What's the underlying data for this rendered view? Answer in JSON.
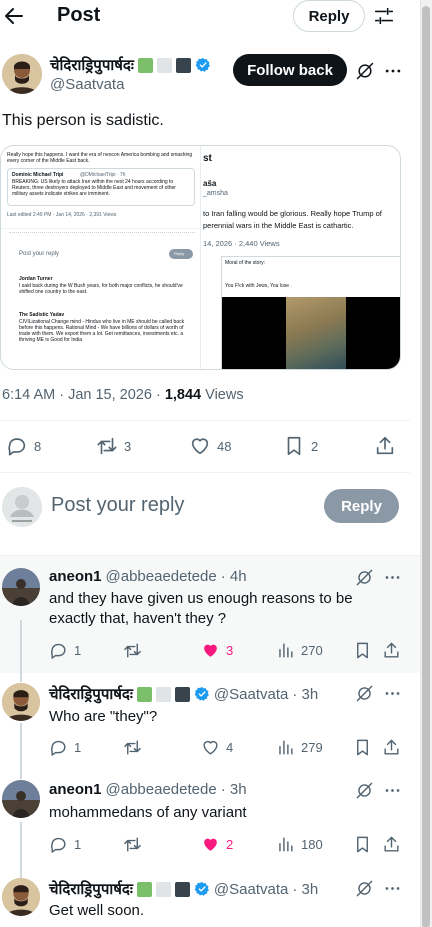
{
  "header": {
    "title": "Post",
    "reply_button": "Reply"
  },
  "main_post": {
    "display_name": "चेदिराड्रिपुपार्षदः",
    "handle": "@Saatvata",
    "follow_label": "Follow back",
    "text": "This person is sadistic.",
    "time": "6:14 AM · Jan 15, 2026 · ",
    "views_count": "1,844",
    "views_label": " Views",
    "stats": {
      "replies": "8",
      "reposts": "3",
      "likes": "48",
      "bookmarks": "2"
    },
    "flag_colors": [
      "#7bbf6a",
      "#e1e4e6",
      "#38444d"
    ]
  },
  "quoted_media": {
    "left_card": {
      "intro": "Really hope this happens. I want the era of neocon America bombing and smashing every corner of the Middle East back.",
      "quoted_name": "Dominic Michael Tripi",
      "quoted_handle": "@DMichaelTripi · 7h",
      "quoted_text": "BREAKING: US likely to attack Iran within the next 24 hours according to Reuters, three destroyers deployed to Middle East and movement of other military assets indicate strikes are imminent.",
      "stamp": "Last edited 2:49 PM · Jan 14, 2026 · 2,391 Views",
      "post_reply": "Post your reply",
      "reply": "Reply",
      "reply1_name": "Jordan Turner",
      "reply1_text": "I said back during the W Bush years, for both major conflicts, he should've shifted one country to the east.",
      "reply2_name": "The Sadistic Yadav",
      "reply2_text": "CIVILizational Change mind - Hindus who live in ME should be called back before this happens. Rational Mind - We have billions of dollars of worth of trade with them. We export them a lot. Get remittances, investments etc. a thriving ME is Good for India"
    },
    "right_card": {
      "title": "st",
      "name_part": "aša",
      "handle_part": "_amsha",
      "text": "to Iran falling would be glorious. Really hope Trump of perennial wars in the Middle East is cathartic.",
      "date": "14, 2026 · 2,440 Views",
      "moral": "Moral of the story:",
      "caption": "You F!ck with Jews, You lose ."
    }
  },
  "composer": {
    "placeholder": "Post your reply",
    "button": "Reply"
  },
  "replies": [
    {
      "name": "aneon1",
      "handle": "@abbeaedetede",
      "time": "· 4h",
      "text": "and they have given us enough reasons to be exactly that, haven't they ?",
      "replies": "1",
      "reposts": "",
      "likes": "3",
      "liked": true,
      "views": "270"
    },
    {
      "name": "चेदिराड्रिपुपार्षदः",
      "handle": "@Saatvata",
      "time": "· 3h",
      "text": "Who are \"they\"?",
      "replies": "1",
      "reposts": "",
      "likes": "4",
      "liked": false,
      "views": "279"
    },
    {
      "name": "aneon1",
      "handle": "@abbeaedetede",
      "time": "· 3h",
      "text": "mohammedans of any variant",
      "replies": "1",
      "reposts": "",
      "likes": "2",
      "liked": true,
      "views": "180"
    },
    {
      "name": "चेदिराड्रिपुपार्षदः",
      "handle": "@Saatvata",
      "time": "· 3h",
      "text": "Get well soon."
    }
  ],
  "colors": {
    "like_active": "#f91880",
    "verified": "#1d9bf0",
    "text_secondary": "#536471"
  },
  "icons": [
    "back-arrow-icon",
    "filter-icon",
    "grok-icon",
    "more-icon",
    "reply-icon",
    "repost-icon",
    "like-icon",
    "bookmark-icon",
    "share-icon",
    "views-icon",
    "verified-icon"
  ]
}
